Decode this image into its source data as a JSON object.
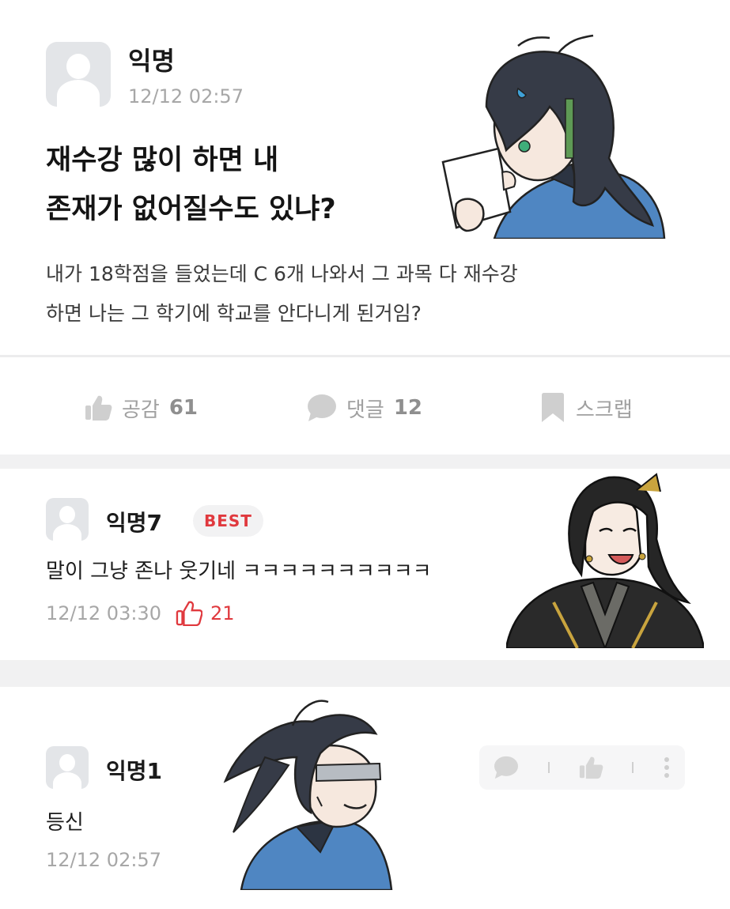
{
  "post": {
    "author": "익명",
    "time": "12/12 02:57",
    "title_line1": "재수강 많이 하면 내",
    "title_line2": "존재가 없어질수도 있냐?",
    "body_line1": "내가 18학점을 들었는데 C 6개 나와서 그 과목 다 재수강",
    "body_line2": "하면 나는 그 학기에 학교를 안다니게 된거임?"
  },
  "actions": {
    "like_label": "공감",
    "like_count": "61",
    "comment_label": "댓글",
    "comment_count": "12",
    "scrap_label": "스크랩"
  },
  "comments": [
    {
      "author": "익명7",
      "badge": "BEST",
      "text": "말이 그냥 존나 웃기네 ㅋㅋㅋㅋㅋㅋㅋㅋㅋㅋ",
      "time": "12/12 03:30",
      "likes": "21"
    },
    {
      "author": "익명1",
      "text": "등신",
      "time": "12/12 02:57"
    }
  ],
  "colors": {
    "accent_red": "#e0393e",
    "gray_text": "#a7a7a7",
    "divider": "#f1f1f2"
  },
  "icons": [
    "thumbs-up-icon",
    "speech-bubble-icon",
    "bookmark-icon",
    "more-vert-icon"
  ]
}
